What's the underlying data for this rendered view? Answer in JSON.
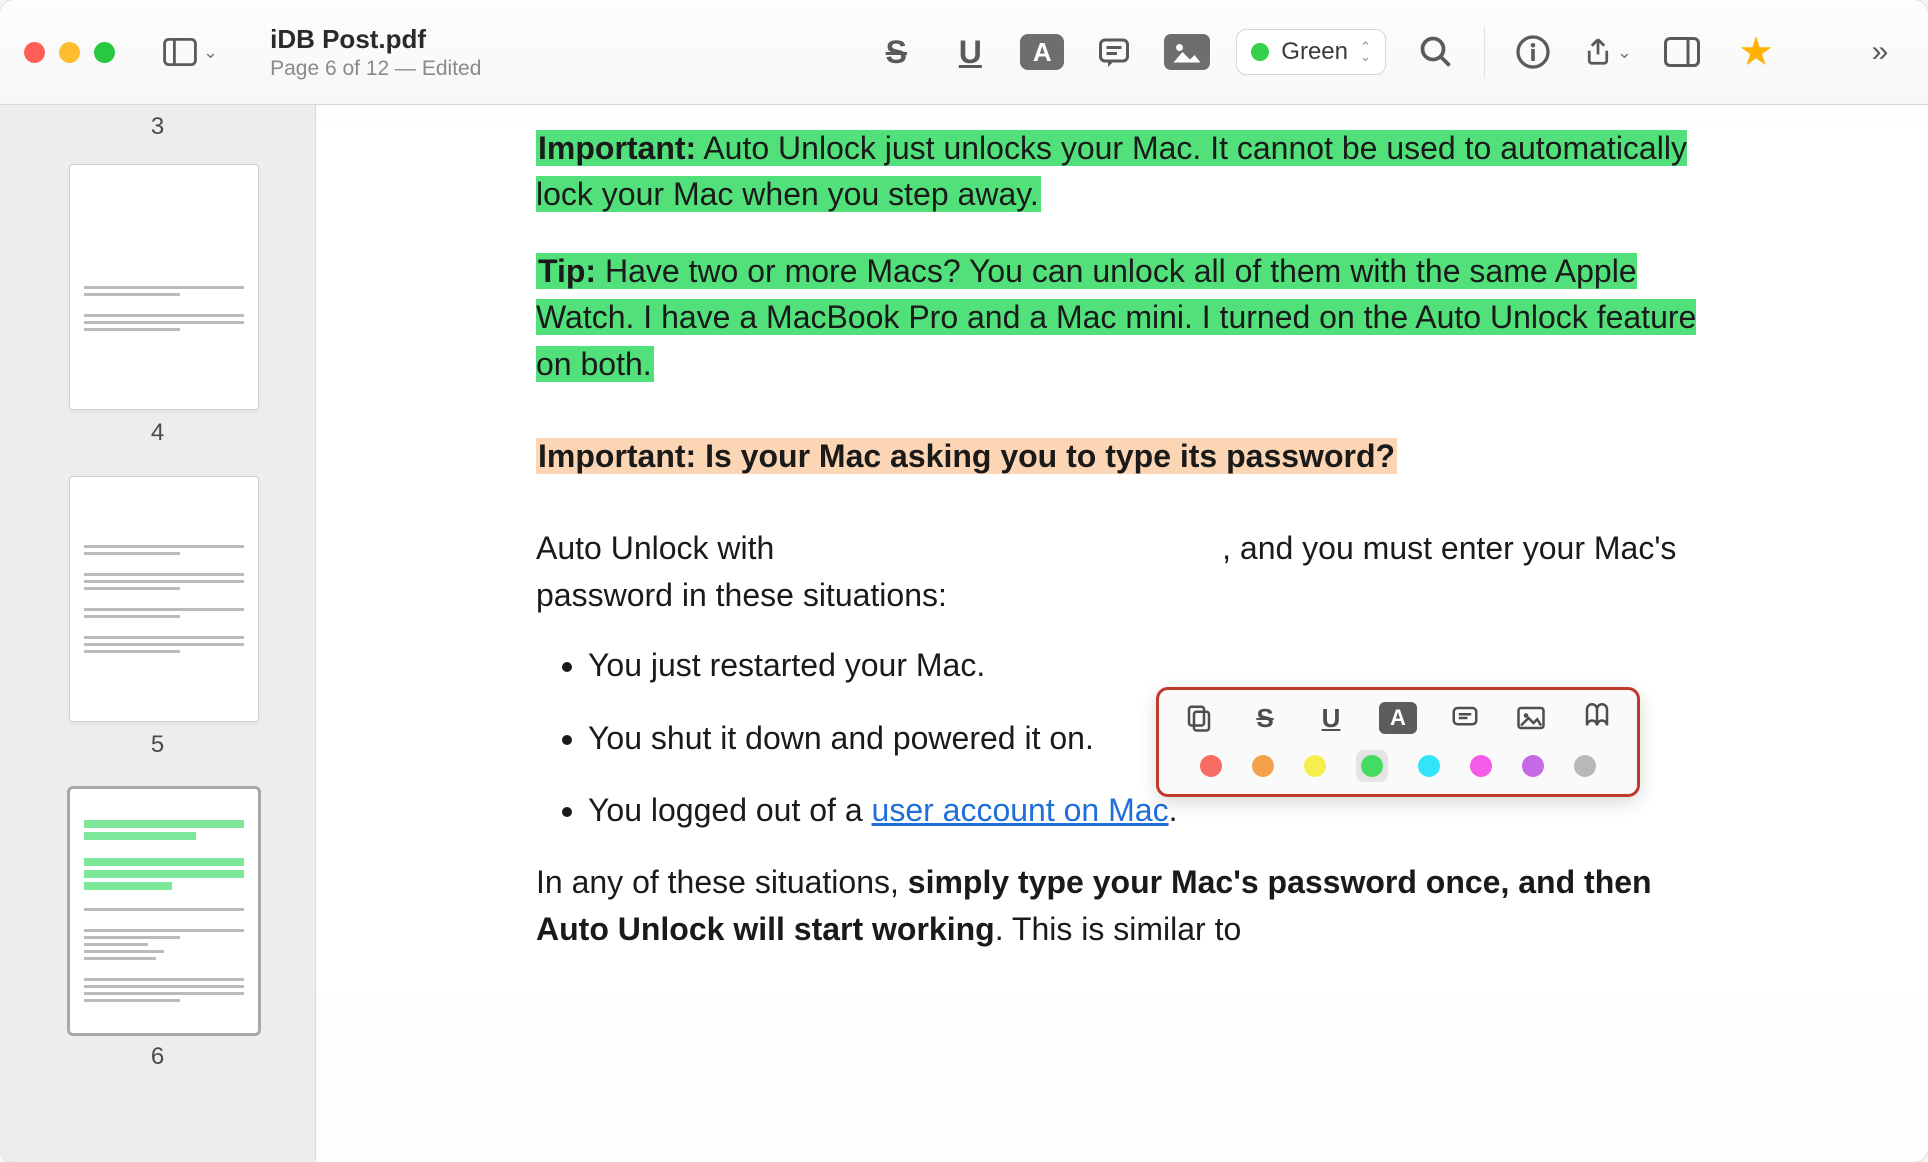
{
  "window": {
    "title": "iDB Post.pdf",
    "subtitle": "Page 6 of 12 — Edited"
  },
  "toolbar": {
    "highlight_label": "Green"
  },
  "sidebar": {
    "top_page": "3",
    "thumbs": [
      {
        "page": "4"
      },
      {
        "page": "5"
      },
      {
        "page": "6"
      }
    ]
  },
  "content": {
    "p1_bold": "Important:",
    "p1_rest": " Auto Unlock just unlocks your Mac. It cannot be used to automatically lock your Mac when you step away.",
    "p2_bold": "Tip:",
    "p2_rest": " Have two or more Macs? You can unlock all of them with the same Apple Watch. I have a MacBook Pro and a Mac mini. I turned on the Auto Unlock feature on both.",
    "p3": "Important: Is your Mac asking you to type its password?",
    "p4_a": "Auto Unlock with",
    "p4_b": ", and you must enter your Mac's password in these situations:",
    "b1": "You just restarted your Mac.",
    "b2": "You shut it down and powered it on.",
    "b3_a": "You logged out of a ",
    "b3_link": "user account on Mac",
    "b3_b": ".",
    "p5_a": "In any of these situations, ",
    "p5_bold": "simply type your Mac's password once, and then Auto Unlock will start working",
    "p5_b": ". This is similar to"
  },
  "popover": {
    "colors": [
      "#f76d63",
      "#f3a24a",
      "#f5ee4e",
      "#45db62",
      "#33e3f9",
      "#f45be6",
      "#c569e6",
      "#b8b8b8"
    ],
    "selected_index": 3
  }
}
